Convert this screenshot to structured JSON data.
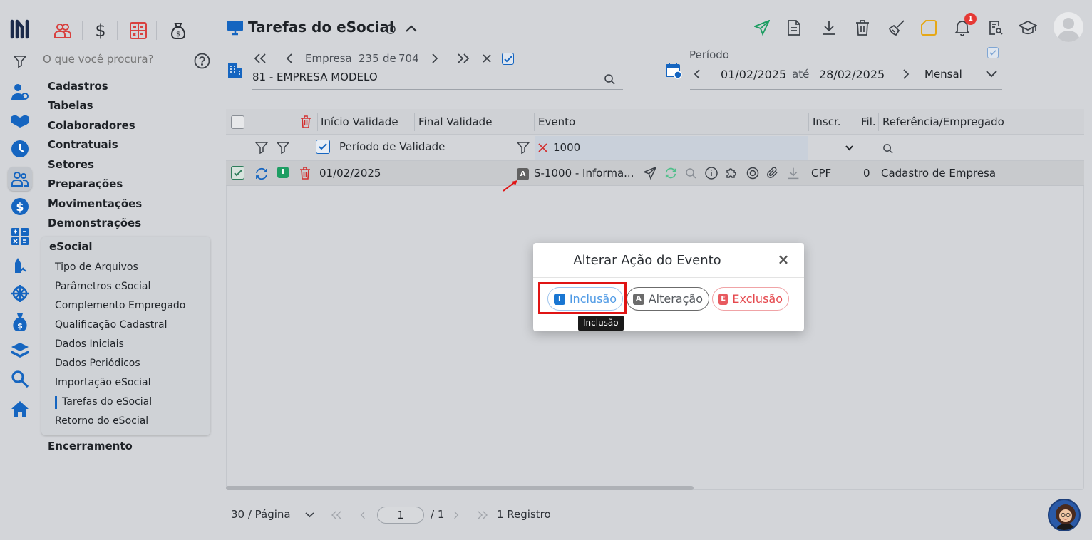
{
  "search": {
    "placeholder": "O que você procura?"
  },
  "menu": {
    "items": [
      "Cadastros",
      "Tabelas",
      "Colaboradores",
      "Contratuais",
      "Setores",
      "Preparações",
      "Movimentações",
      "Demonstrações"
    ],
    "esocial_title": "eSocial",
    "esocial_items": [
      "Tipo de Arquivos",
      "Parâmetros eSocial",
      "Complemento Empregado",
      "Qualificação Cadastral",
      "Dados Iniciais",
      "Dados Periódicos",
      "Importação eSocial",
      "Tarefas do eSocial",
      "Retorno do eSocial"
    ],
    "active": "Tarefas do eSocial",
    "after": "Encerramento"
  },
  "header": {
    "title": "Tarefas do eSocial",
    "notifications": "1"
  },
  "company": {
    "nav_label": "Empresa",
    "current": "235",
    "of_label": "de",
    "total": "704",
    "selected": "81 - EMPRESA MODELO"
  },
  "period": {
    "label": "Período",
    "start": "01/02/2025",
    "until": "até",
    "end": "28/02/2025",
    "type": "Mensal"
  },
  "grid": {
    "columns": [
      "Início Validade",
      "Final Validade",
      "Evento",
      "Inscr.",
      "Fil.",
      "Referência/Empregado"
    ],
    "filter_period": "Período de Validade",
    "filter_event": "1000",
    "row": {
      "inicio": "01/02/2025",
      "action_badge": "A",
      "status_badge": "I",
      "evento": "S-1000 - Informa...",
      "inscr": "CPF",
      "fil": "0",
      "referencia": "Cadastro de Empresa"
    }
  },
  "pagination": {
    "per_page": "30 / Página",
    "page": "1",
    "total_pages": "/ 1",
    "records": "1 Registro"
  },
  "modal": {
    "title": "Alterar Ação do Evento",
    "buttons": [
      {
        "badge": "I",
        "label": "Inclusão",
        "color": "#1976d2"
      },
      {
        "badge": "A",
        "label": "Alteração",
        "color": "#6b6b6b"
      },
      {
        "badge": "E",
        "label": "Exclusão",
        "color": "#e5484d"
      }
    ],
    "tooltip": "Inclusão"
  },
  "colors": {
    "accent": "#1565c0",
    "danger": "#d32f2f",
    "success": "#1e9e63"
  }
}
